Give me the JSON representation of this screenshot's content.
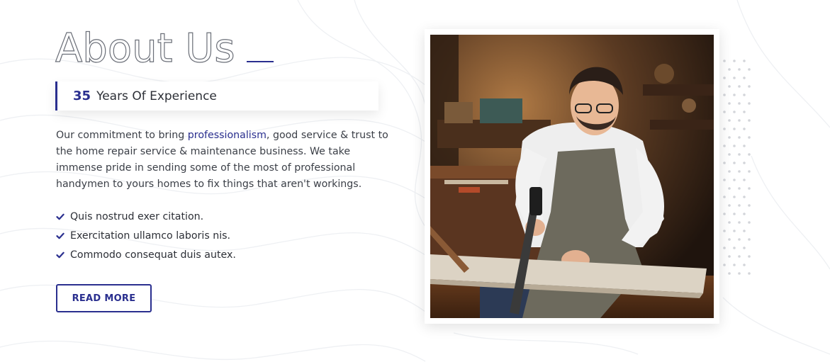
{
  "about": {
    "title": "About Us",
    "experience_number": "35",
    "experience_text": "Years Of Experience",
    "paragraph_before": "Our commitment to bring ",
    "paragraph_highlight": "professionalism",
    "paragraph_after": ", good service & trust to the home repair service & maintenance business. We take immense pride in sending some of the most of professional handymen to yours homes to fix things that aren't workings.",
    "checklist": [
      "Quis nostrud exer citation.",
      "Exercitation ullamco laboris nis.",
      "Commodo consequat duis autex."
    ],
    "button_label": "READ MORE"
  },
  "image": {
    "icon": "carpenter-photo"
  },
  "colors": {
    "accent": "#2a2f8f",
    "text": "#3b3f47",
    "dots": "#d3d5da"
  }
}
